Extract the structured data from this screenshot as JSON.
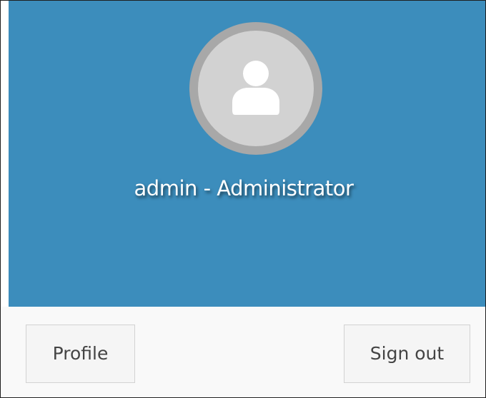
{
  "user": {
    "display_name": "admin - Administrator",
    "avatar_icon": "user-silhouette-icon"
  },
  "colors": {
    "header_background": "#3c8dbc",
    "footer_background": "#f9f9f9",
    "avatar_ring": "#a8a8a8",
    "avatar_fill": "#d2d2d2"
  },
  "footer": {
    "profile_label": "Profile",
    "signout_label": "Sign out"
  }
}
